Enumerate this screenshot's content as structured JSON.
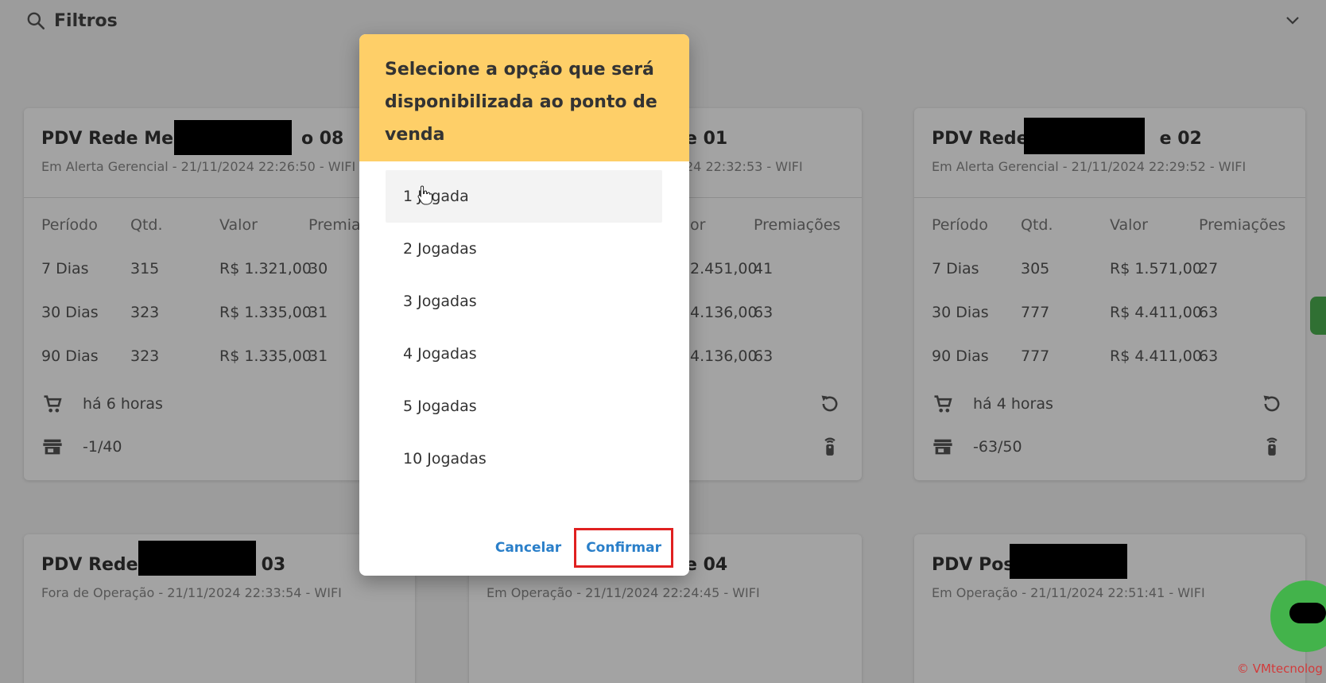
{
  "filter": {
    "title": "Filtros"
  },
  "cards": [
    {
      "title": "PDV Rede Mer",
      "title_suffix": "o 08",
      "subtitle": "Em Alerta Gerencial - 21/11/2024 22:26:50 - WIFI",
      "headers": [
        "Período",
        "Qtd.",
        "Valor",
        "Premia"
      ],
      "rows": [
        [
          "7 Dias",
          "315",
          "R$ 1.321,00",
          "30"
        ],
        [
          "30 Dias",
          "323",
          "R$ 1.335,00",
          "31"
        ],
        [
          "90 Dias",
          "323",
          "R$ 1.335,00",
          "31"
        ]
      ],
      "last_sale": "há 6 horas",
      "stock": "-1/40"
    },
    {
      "title_suffix": "e 01",
      "subtitle": "24 22:32:53 - WIFI",
      "headers": [
        "or",
        "Premiações"
      ],
      "rows": [
        [
          "2.451,00",
          "41"
        ],
        [
          "4.136,00",
          "63"
        ],
        [
          "4.136,00",
          "63"
        ]
      ]
    },
    {
      "title": "PDV Rede",
      "title_suffix": "e 02",
      "subtitle": "Em Alerta Gerencial - 21/11/2024 22:29:52 - WIFI",
      "headers": [
        "Período",
        "Qtd.",
        "Valor",
        "Premiações"
      ],
      "rows": [
        [
          "7 Dias",
          "305",
          "R$ 1.571,00",
          "27"
        ],
        [
          "30 Dias",
          "777",
          "R$ 4.411,00",
          "63"
        ],
        [
          "90 Dias",
          "777",
          "R$ 4.411,00",
          "63"
        ]
      ],
      "last_sale": "há 4 horas",
      "stock": "-63/50"
    },
    {
      "title": "PDV Rede",
      "title_suffix": "03",
      "subtitle": "Fora de Operação - 21/11/2024 22:33:54 - WIFI"
    },
    {
      "title_suffix": "e 04",
      "subtitle": "Em Operação - 21/11/2024 22:24:45 - WIFI"
    },
    {
      "title": "PDV Post",
      "subtitle": "Em Operação - 21/11/2024 22:51:41 - WIFI"
    }
  ],
  "modal": {
    "title": "Selecione a opção que será disponibilizada ao ponto de venda",
    "options": [
      "1 Jogada",
      "2 Jogadas",
      "3 Jogadas",
      "4 Jogadas",
      "5 Jogadas",
      "10 Jogadas"
    ],
    "cancel_label": "Cancelar",
    "confirm_label": "Confirmar"
  },
  "footer": {
    "brand": "© VMtecnolog"
  },
  "colors": {
    "modal_header": "#fecf68",
    "action_blue": "#2a7fc9",
    "highlight_red": "#e02020",
    "chat_green": "#43b34b"
  }
}
